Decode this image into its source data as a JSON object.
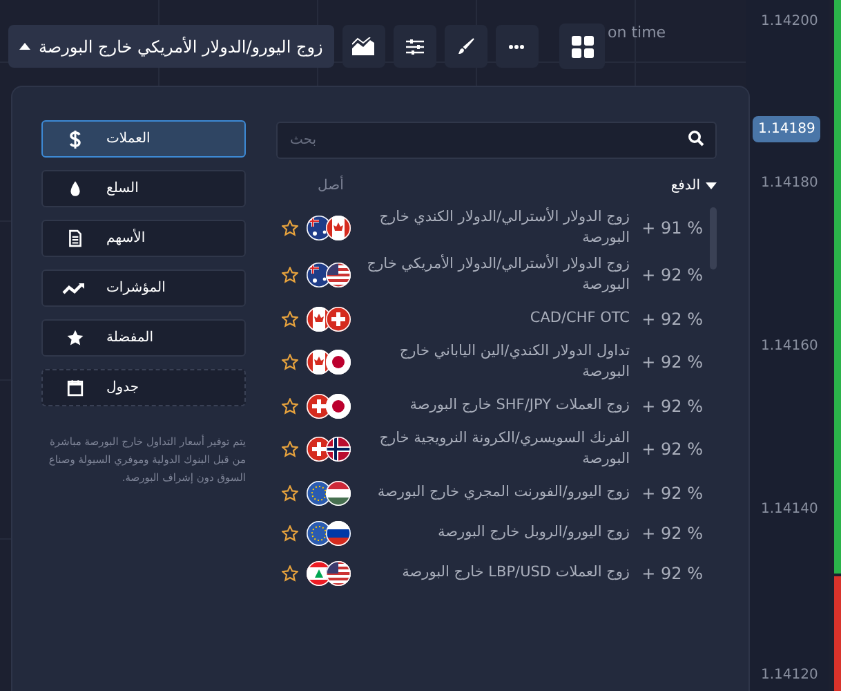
{
  "toolbar": {
    "asset": "زوج اليورو/الدولار الأمريكي خارج البورصة",
    "expanded": true,
    "overlay_text": "on time"
  },
  "price_axis": {
    "current": "1.14189",
    "labels": [
      "1.14200",
      "1.14180",
      "1.14160",
      "1.14140",
      "1.14120"
    ]
  },
  "categories": [
    {
      "label": "العملات",
      "kind": "currencies",
      "selected": true
    },
    {
      "label": "السلع",
      "kind": "commodities",
      "selected": false
    },
    {
      "label": "الأسهم",
      "kind": "stocks",
      "selected": false
    },
    {
      "label": "المؤشرات",
      "kind": "indices",
      "selected": false
    },
    {
      "label": "المفضلة",
      "kind": "favorites",
      "selected": false
    },
    {
      "label": "جدول",
      "kind": "schedule",
      "selected": false
    }
  ],
  "note": "يتم توفير أسعار التداول خارج البورصة مباشرة من قبل البنوك الدولية وموفري السيولة وصناع السوق دون إشراف البورصة.",
  "search": {
    "placeholder": "بحث"
  },
  "columns": {
    "payout": "الدفع",
    "asset": "أصل"
  },
  "assets": [
    {
      "name": "زوج الدولار الأسترالي/الدولار الكندي خارج البورصة",
      "payout": "+ 91 %",
      "favorite": false
    },
    {
      "name": "زوج الدولار الأسترالي/الدولار الأمريكي خارج البورصة",
      "payout": "+ 92 %",
      "favorite": false
    },
    {
      "name": "CAD/CHF OTC",
      "payout": "+ 92 %",
      "favorite": false
    },
    {
      "name": "تداول الدولار الكندي/الين الياباني خارج البورصة",
      "payout": "+ 92 %",
      "favorite": false
    },
    {
      "name": "زوج العملات SHF/JPY خارج البورصة",
      "payout": "+ 92 %",
      "favorite": false
    },
    {
      "name": "الفرنك السويسري/الكرونة النرويجية خارج البورصة",
      "payout": "+ 92 %",
      "favorite": false
    },
    {
      "name": "زوج اليورو/الفورنت المجري خارج البورصة",
      "payout": "+ 92 %",
      "favorite": false
    },
    {
      "name": "زوج اليورو/الروبل خارج البورصة",
      "payout": "+ 92 %",
      "favorite": false
    },
    {
      "name": "زوج العملات LBP/USD خارج البورصة",
      "payout": "+ 92 %",
      "favorite": false
    }
  ]
}
